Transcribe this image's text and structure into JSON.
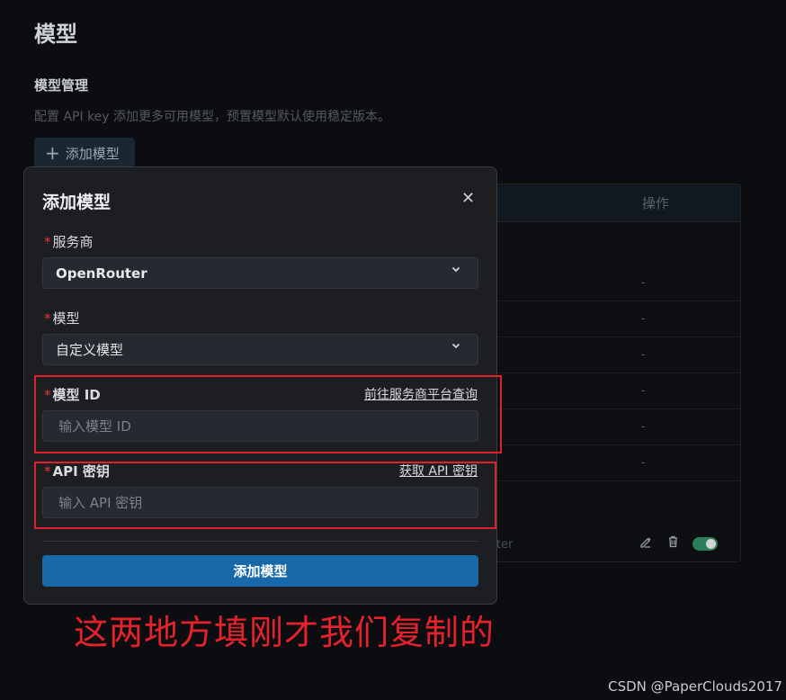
{
  "page": {
    "title": "模型",
    "section_title": "模型管理",
    "section_desc": "配置 API key 添加更多可用模型，预置模型默认使用稳定版本。",
    "add_button_label": "添加模型"
  },
  "table": {
    "ops_header": "操作",
    "row_dashes": [
      "-",
      "-",
      "-",
      "-",
      "-",
      "-"
    ],
    "last_row_provider_partial": "ter",
    "toggle_on": true
  },
  "modal": {
    "title": "添加模型",
    "provider": {
      "label": "服务商",
      "value": "OpenRouter"
    },
    "model": {
      "label": "模型",
      "value": "自定义模型"
    },
    "model_id": {
      "label": "模型 ID",
      "link": "前往服务商平台查询",
      "placeholder": "输入模型 ID"
    },
    "api_key": {
      "label": "API 密钥",
      "link": "获取 API 密钥",
      "placeholder": "输入 API 密钥"
    },
    "submit_label": "添加模型"
  },
  "annotation": {
    "text": "这两地方填刚才我们复制的",
    "color": "#e5222b"
  },
  "watermark": "CSDN @PaperClouds2017",
  "colors": {
    "accent": "#1769aa",
    "required": "#e53935",
    "toggle": "#2b7e5b"
  }
}
